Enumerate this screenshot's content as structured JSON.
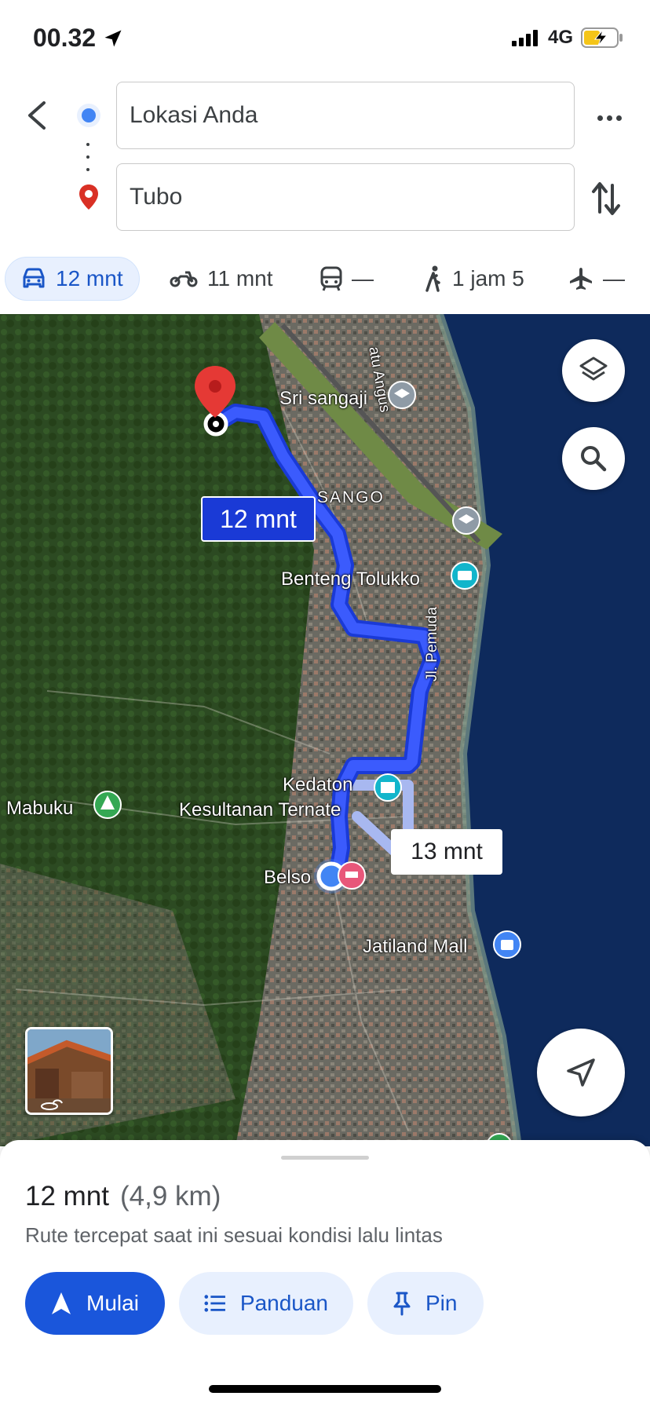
{
  "status_bar": {
    "time": "00.32",
    "network": "4G",
    "icons": [
      "location-arrow-icon",
      "signal-icon",
      "battery-charging-icon"
    ]
  },
  "directions": {
    "origin": "Lokasi Anda",
    "destination": "Tubo"
  },
  "modes": [
    {
      "icon": "car-icon",
      "label": "12 mnt",
      "active": true
    },
    {
      "icon": "motorcycle-icon",
      "label": "11 mnt",
      "active": false
    },
    {
      "icon": "transit-icon",
      "label": "—",
      "active": false
    },
    {
      "icon": "walk-icon",
      "label": "1 jam 5",
      "active": false
    },
    {
      "icon": "flight-icon",
      "label": "—",
      "active": false
    }
  ],
  "map": {
    "labels": {
      "sri_sangaji": "Sri sangaji",
      "sango": "SANGO",
      "benteng": "Benteng Tolukko",
      "jl_pemuda": "Jl. Pemuda",
      "kedaton": "Kedaton",
      "kesultanan": "Kesultanan Ternate",
      "mabuku": "Mabuku",
      "belso": "Belso",
      "jatiland": "Jatiland Mall",
      "batu_angus": "atu Angus"
    },
    "primary_route_time": "12 mnt",
    "alt_route_time": "13 mnt",
    "colors": {
      "route": "#3b5bfd",
      "route_alt": "#a8b8f0",
      "pin": "#e53935",
      "sea": "#0e2a5c"
    }
  },
  "summary": {
    "duration": "12 mnt",
    "distance": "(4,9 km)",
    "description": "Rute tercepat saat ini sesuai kondisi lalu lintas"
  },
  "actions": {
    "start": "Mulai",
    "guide": "Panduan",
    "pin": "Pin"
  }
}
